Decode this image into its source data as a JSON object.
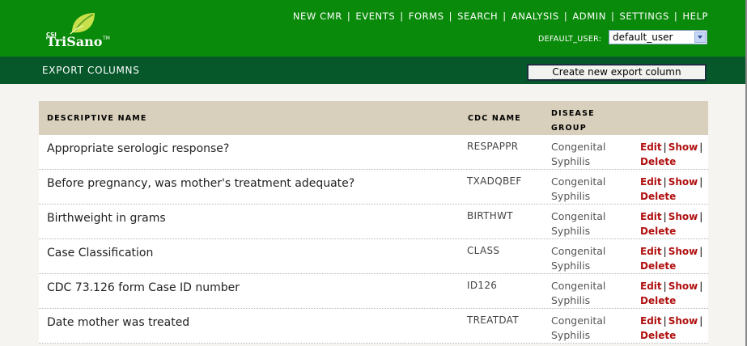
{
  "brand": {
    "prefix": "CSI",
    "name": "TriSano",
    "tm": "TM"
  },
  "nav": {
    "items": [
      "NEW CMR",
      "EVENTS",
      "FORMS",
      "SEARCH",
      "ANALYSIS",
      "ADMIN",
      "SETTINGS",
      "HELP"
    ],
    "separator": "|"
  },
  "user": {
    "label": "DEFAULT_USER:",
    "selected": "default_user"
  },
  "page": {
    "title": "EXPORT COLUMNS",
    "create_button": "Create new export column"
  },
  "table": {
    "headers": {
      "descriptive_name": "DESCRIPTIVE NAME",
      "cdc_name": "CDC NAME",
      "disease_group_line1": "DISEASE",
      "disease_group_line2": "GROUP"
    },
    "action_labels": {
      "edit": "Edit",
      "show": "Show",
      "delete": "Delete",
      "sep": "|"
    },
    "rows": [
      {
        "descriptive_name": "Appropriate serologic response?",
        "cdc_name": "RESPAPPR",
        "group_line1": "Congenital",
        "group_line2": "Syphilis"
      },
      {
        "descriptive_name": "Before pregnancy, was mother's treatment adequate?",
        "cdc_name": "TXADQBEF",
        "group_line1": "Congenital",
        "group_line2": "Syphilis"
      },
      {
        "descriptive_name": "Birthweight in grams",
        "cdc_name": "BIRTHWT",
        "group_line1": "Congenital",
        "group_line2": "Syphilis"
      },
      {
        "descriptive_name": "Case Classification",
        "cdc_name": "CLASS",
        "group_line1": "Congenital",
        "group_line2": "Syphilis"
      },
      {
        "descriptive_name": "CDC 73.126 form Case ID number",
        "cdc_name": "ID126",
        "group_line1": "Congenital",
        "group_line2": "Syphilis"
      },
      {
        "descriptive_name": "Date mother was treated",
        "cdc_name": "TREATDAT",
        "group_line1": "Congenital",
        "group_line2": "Syphilis"
      }
    ]
  },
  "colors": {
    "header_green": "#0a8a0a",
    "subbar_green": "#06582a",
    "table_header": "#d8d0bc",
    "link_red": "#b01010"
  }
}
